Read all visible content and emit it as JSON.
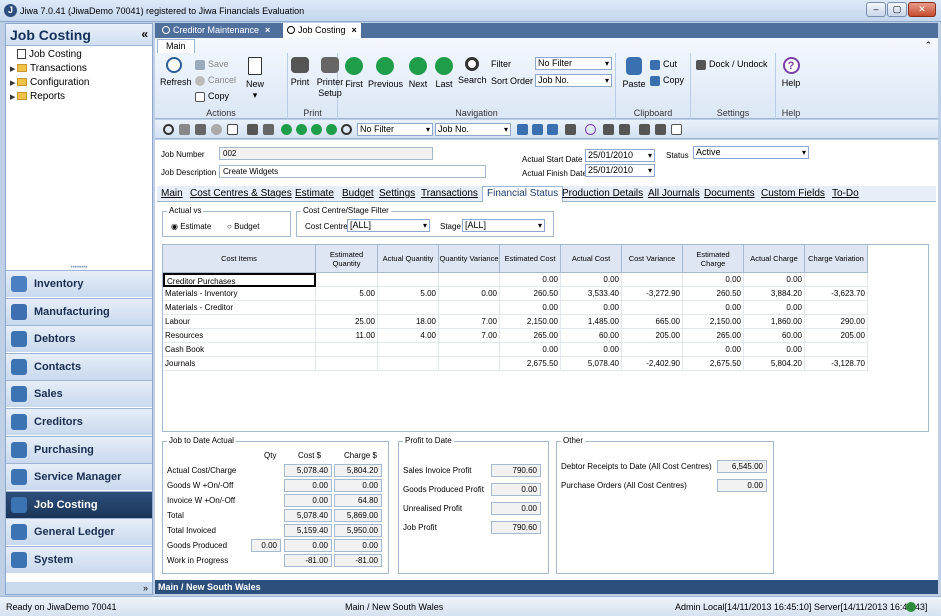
{
  "window": {
    "title": "Jiwa 7.0.41 (JiwaDemo 70041) registered to Jiwa Financials Evaluation"
  },
  "sidebar": {
    "title": "Job Costing",
    "tree": [
      {
        "label": "Job Costing",
        "type": "doc"
      },
      {
        "label": "Transactions",
        "type": "folder"
      },
      {
        "label": "Configuration",
        "type": "folder"
      },
      {
        "label": "Reports",
        "type": "folder"
      }
    ],
    "nav": [
      {
        "label": "Inventory",
        "icon": "inventory-icon",
        "color": "#4a7fc1"
      },
      {
        "label": "Manufacturing",
        "icon": "wrench-icon",
        "color": "#3e6fb0"
      },
      {
        "label": "Debtors",
        "icon": "debtors-icon",
        "color": "#3b73b3"
      },
      {
        "label": "Contacts",
        "icon": "contacts-icon",
        "color": "#3b73b3"
      },
      {
        "label": "Sales",
        "icon": "sales-icon",
        "color": "#3b73b3"
      },
      {
        "label": "Creditors",
        "icon": "creditors-icon",
        "color": "#3b73b3"
      },
      {
        "label": "Purchasing",
        "icon": "purchasing-icon",
        "color": "#3b73b3"
      },
      {
        "label": "Service Manager",
        "icon": "service-icon",
        "color": "#3b73b3"
      },
      {
        "label": "Job Costing",
        "icon": "job-costing-icon",
        "color": "#3b73b3",
        "active": true
      },
      {
        "label": "General Ledger",
        "icon": "ledger-icon",
        "color": "#3b73b3"
      },
      {
        "label": "System",
        "icon": "system-icon",
        "color": "#3b73b3"
      }
    ],
    "footer_glyph": "»"
  },
  "doc_tabs": [
    {
      "label": "Creditor Maintenance",
      "close": "×"
    },
    {
      "label": "Job Costing",
      "close": "×",
      "active": true
    }
  ],
  "ribbon": {
    "tab": "Main",
    "collapse_glyph": "⌃",
    "groups": {
      "actions": "Actions",
      "print": "Print",
      "navigation": "Navigation",
      "clipboard": "Clipboard",
      "settings": "Settings",
      "help": "Help"
    },
    "buttons": {
      "refresh": "Refresh",
      "save": "Save",
      "cancel": "Cancel",
      "copy": "Copy",
      "new": "New",
      "print": "Print",
      "printer_setup": "Printer Setup",
      "first": "First",
      "previous": "Previous",
      "next": "Next",
      "last": "Last",
      "search": "Search",
      "filter": "Filter",
      "sort_order": "Sort Order",
      "paste": "Paste",
      "cut": "Cut",
      "copy2": "Copy",
      "dock": "Dock / Undock",
      "help": "Help"
    },
    "filter_value": "No Filter",
    "sort_value": "Job No."
  },
  "toolbar": {
    "filter_value": "No Filter",
    "sort_value": "Job No."
  },
  "header": {
    "job_number_label": "Job Number",
    "job_number": "002",
    "job_desc_label": "Job Description",
    "job_desc": "Create Widgets",
    "start_label": "Actual Start Date",
    "start": "25/01/2010",
    "finish_label": "Actual Finish Date",
    "finish": "25/01/2010",
    "status_label": "Status",
    "status": "Active"
  },
  "subtabs": [
    "Main",
    "Cost Centres & Stages",
    "Estimate",
    "Budget",
    "Settings",
    "Transactions",
    "Financial Status",
    "Production Details",
    "All Journals",
    "Documents",
    "Custom Fields",
    "To-Do"
  ],
  "active_subtab": "Financial Status",
  "filters": {
    "actual_vs_title": "Actual vs",
    "estimate": "Estimate",
    "budget": "Budget",
    "selected": "Estimate",
    "cc_title": "Cost Centre/Stage Filter",
    "cost_centre_label": "Cost Centre",
    "cost_centre": "[ALL]",
    "stage_label": "Stage",
    "stage": "[ALL]"
  },
  "grid": {
    "columns": [
      "Cost Items",
      "Estimated Quantity",
      "Actual Quantity",
      "Quantity Variance",
      "Estimated Cost",
      "Actual Cost",
      "Cost Variance",
      "Estimated Charge",
      "Actual Charge",
      "Charge Variation"
    ],
    "rows": [
      [
        "Creditor Purchases",
        "",
        "",
        "",
        "0.00",
        "0.00",
        "",
        "0.00",
        "0.00",
        ""
      ],
      [
        "Materials - Inventory",
        "5.00",
        "5.00",
        "0.00",
        "260.50",
        "3,533.40",
        "-3,272.90",
        "260.50",
        "3,884.20",
        "-3,623.70"
      ],
      [
        "Materials - Creditor",
        "",
        "",
        "",
        "0.00",
        "0.00",
        "",
        "0.00",
        "0.00",
        ""
      ],
      [
        "Labour",
        "25.00",
        "18.00",
        "7.00",
        "2,150.00",
        "1,485.00",
        "665.00",
        "2,150.00",
        "1,860.00",
        "290.00"
      ],
      [
        "Resources",
        "11.00",
        "4.00",
        "7.00",
        "265.00",
        "60.00",
        "205.00",
        "265.00",
        "60.00",
        "205.00"
      ],
      [
        "Cash Book",
        "",
        "",
        "",
        "0.00",
        "0.00",
        "",
        "0.00",
        "0.00",
        ""
      ],
      [
        "Journals",
        "",
        "",
        "",
        "2,675.50",
        "5,078.40",
        "-2,402.90",
        "2,675.50",
        "5,804.20",
        "-3,128.70"
      ]
    ]
  },
  "jtd": {
    "title": "Job to Date Actual",
    "col_qty": "Qty",
    "col_cost": "Cost $",
    "col_charge": "Charge $",
    "rows": [
      {
        "label": "Actual Cost/Charge",
        "qty": "",
        "cost": "5,078.40",
        "charge": "5,804.20"
      },
      {
        "label": "Goods W +On/-Off",
        "qty": "",
        "cost": "0.00",
        "charge": "0.00"
      },
      {
        "label": "Invoice W +On/-Off",
        "qty": "",
        "cost": "0.00",
        "charge": "64.80"
      },
      {
        "label": "Total",
        "qty": "",
        "cost": "5,078.40",
        "charge": "5,869.00"
      },
      {
        "label": "Total Invoiced",
        "qty": "",
        "cost": "5,159.40",
        "charge": "5,950.00"
      },
      {
        "label": "Goods Produced",
        "qty": "0.00",
        "cost": "0.00",
        "charge": "0.00"
      },
      {
        "label": "Work in Progress",
        "qty": "",
        "cost": "-81.00",
        "charge": "-81.00"
      }
    ]
  },
  "ptd": {
    "title": "Profit to Date",
    "rows": [
      {
        "label": "Sales Invoice Profit",
        "value": "790.60"
      },
      {
        "label": "Goods Produced Profit",
        "value": "0.00"
      },
      {
        "label": "Unrealised Profit",
        "value": "0.00"
      },
      {
        "label": "Job Profit",
        "value": "790.60"
      }
    ]
  },
  "other": {
    "title": "Other",
    "rows": [
      {
        "label": "Debtor Receipts to Date (All Cost Centres)",
        "value": "6,545.00"
      },
      {
        "label": "Purchase Orders (All Cost Centres)",
        "value": "0.00"
      }
    ]
  },
  "bottom_strip": "Main / New South Wales",
  "status": {
    "left": "Ready on JiwaDemo 70041",
    "center": "Main / New South Wales",
    "right": "Admin Local[14/11/2013 16:45:10]  Server[14/11/2013 16:47:43]"
  }
}
